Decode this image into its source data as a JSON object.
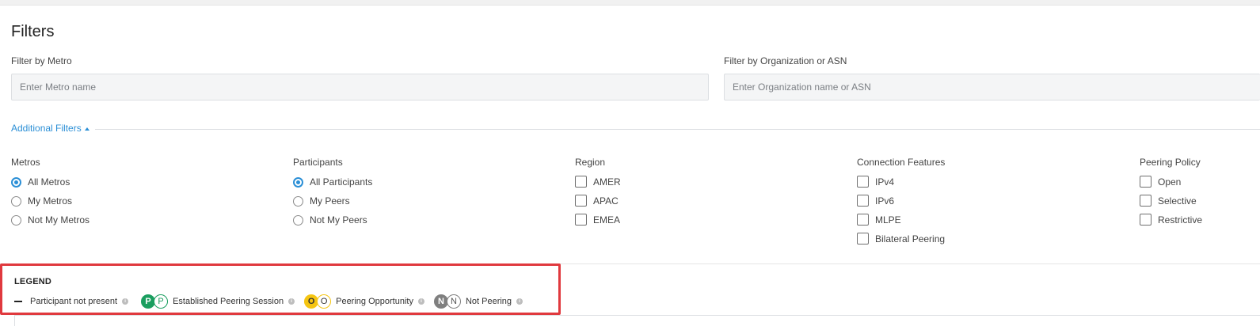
{
  "page": {
    "title": "Filters"
  },
  "filters": {
    "metro": {
      "label": "Filter by Metro",
      "placeholder": "Enter Metro name"
    },
    "org": {
      "label": "Filter by Organization or ASN",
      "placeholder": "Enter Organization name or ASN"
    },
    "additional_label": "Additional Filters"
  },
  "columns": {
    "metros": {
      "title": "Metros",
      "options": [
        {
          "label": "All Metros",
          "selected": true
        },
        {
          "label": "My Metros",
          "selected": false
        },
        {
          "label": "Not My Metros",
          "selected": false
        }
      ]
    },
    "participants": {
      "title": "Participants",
      "options": [
        {
          "label": "All Participants",
          "selected": true
        },
        {
          "label": "My Peers",
          "selected": false
        },
        {
          "label": "Not My Peers",
          "selected": false
        }
      ]
    },
    "region": {
      "title": "Region",
      "options": [
        {
          "label": "AMER",
          "checked": false
        },
        {
          "label": "APAC",
          "checked": false
        },
        {
          "label": "EMEA",
          "checked": false
        }
      ]
    },
    "features": {
      "title": "Connection Features",
      "options": [
        {
          "label": "IPv4",
          "checked": false
        },
        {
          "label": "IPv6",
          "checked": false
        },
        {
          "label": "MLPE",
          "checked": false
        },
        {
          "label": "Bilateral Peering",
          "checked": false
        }
      ]
    },
    "policy": {
      "title": "Peering Policy",
      "options": [
        {
          "label": "Open",
          "checked": false
        },
        {
          "label": "Selective",
          "checked": false
        },
        {
          "label": "Restrictive",
          "checked": false
        }
      ]
    }
  },
  "legend": {
    "title": "LEGEND",
    "items": [
      {
        "label": "Participant not present",
        "icon": "dash-icon"
      },
      {
        "label": "Established Peering Session",
        "letter": "P",
        "color": "#1a9e5f"
      },
      {
        "label": "Peering Opportunity",
        "letter": "O",
        "color": "#f5c512"
      },
      {
        "label": "Not Peering",
        "letter": "N",
        "color": "#7f7f7f"
      }
    ],
    "info_glyph": "i"
  },
  "colors": {
    "accent": "#2b8fd6",
    "highlight_border": "#e0393e"
  }
}
